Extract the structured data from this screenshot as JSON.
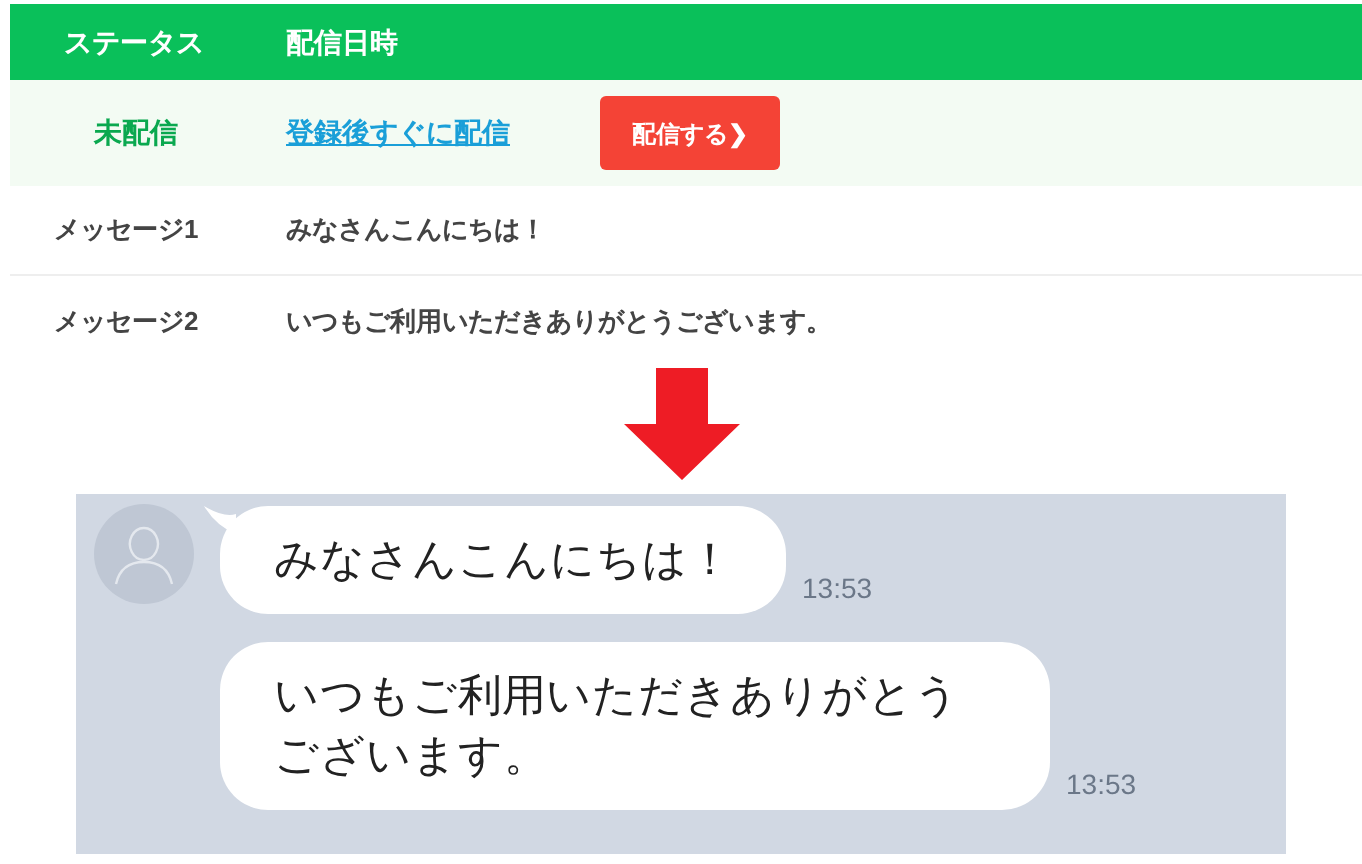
{
  "table": {
    "columns": [
      "ステータス",
      "配信日時"
    ],
    "rows": [
      {
        "kind": "status",
        "status": "未配信",
        "schedule": "登録後すぐに配信",
        "button": "配信する❯"
      },
      {
        "kind": "message",
        "label": "メッセージ1",
        "text": "みなさんこんにちは！"
      },
      {
        "kind": "message",
        "label": "メッセージ2",
        "text": "いつもご利用いただきありがとうございます。"
      }
    ]
  },
  "chat": {
    "messages": [
      {
        "text": "みなさんこんにちは！",
        "time": "13:53",
        "first": true
      },
      {
        "text": "いつもご利用いただきありがとうございます。",
        "time": "13:53",
        "first": false
      }
    ]
  }
}
